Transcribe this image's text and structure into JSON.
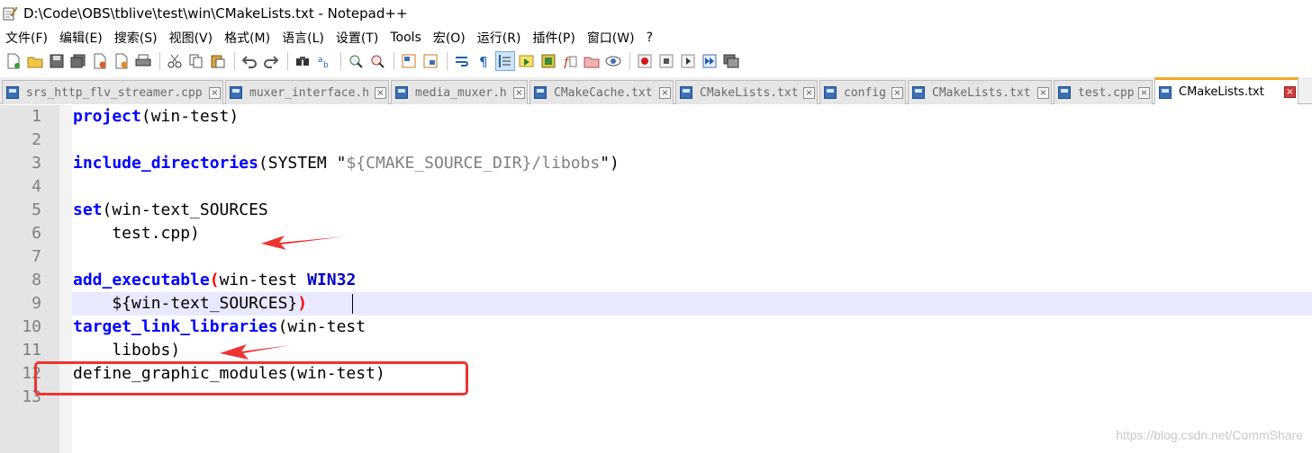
{
  "window": {
    "title": "D:\\Code\\OBS\\tblive\\test\\win\\CMakeLists.txt - Notepad++"
  },
  "menu": [
    {
      "label": "文件(F)"
    },
    {
      "label": "编辑(E)"
    },
    {
      "label": "搜索(S)"
    },
    {
      "label": "视图(V)"
    },
    {
      "label": "格式(M)"
    },
    {
      "label": "语言(L)"
    },
    {
      "label": "设置(T)"
    },
    {
      "label": "Tools"
    },
    {
      "label": "宏(O)"
    },
    {
      "label": "运行(R)"
    },
    {
      "label": "插件(P)"
    },
    {
      "label": "窗口(W)"
    },
    {
      "label": "?"
    }
  ],
  "toolbar": {
    "icons": [
      "new-file-icon",
      "open-file-icon",
      "save-icon",
      "save-all-icon",
      "close-icon",
      "close-all-icon",
      "print-icon",
      "cut-icon",
      "copy-icon",
      "paste-icon",
      "undo-icon",
      "redo-icon",
      "find-icon",
      "replace-icon",
      "zoom-in-icon",
      "zoom-out-icon",
      "sync-vertical-icon",
      "sync-horizontal-icon",
      "word-wrap-icon",
      "show-all-chars-icon",
      "indent-guide-icon",
      "doc-map-icon",
      "function-list-icon",
      "folder-workspace-icon",
      "monitoring-icon",
      "record-macro-icon",
      "stop-record-icon",
      "playback-macro-icon",
      "run-macro-multiple-icon",
      "save-macro-icon"
    ]
  },
  "tabs": [
    {
      "label": "srs_http_flv_streamer.cpp",
      "active": false
    },
    {
      "label": "muxer_interface.h",
      "active": false
    },
    {
      "label": "media_muxer.h",
      "active": false
    },
    {
      "label": "CMakeCache.txt",
      "active": false
    },
    {
      "label": "CMakeLists.txt",
      "active": false
    },
    {
      "label": "config",
      "active": false
    },
    {
      "label": "CMakeLists.txt",
      "active": false
    },
    {
      "label": "test.cpp",
      "active": false
    },
    {
      "label": "CMakeLists.txt",
      "active": true
    }
  ],
  "tab_close_glyph": "×",
  "editor": {
    "line_numbers": [
      "1",
      "2",
      "3",
      "4",
      "5",
      "6",
      "7",
      "8",
      "9",
      "10",
      "11",
      "12",
      "13"
    ],
    "current_line": 9,
    "lines": {
      "l1": {
        "kw": "project",
        "rest": "(win-test)"
      },
      "l3": {
        "kw": "include_directories",
        "rest": "(SYSTEM \"",
        "var": "${CMAKE_SOURCE_DIR}/libobs",
        "end": "\")"
      },
      "l5": {
        "kw": "set",
        "rest": "(win-text_SOURCES"
      },
      "l6": {
        "text": "    test.cpp)"
      },
      "l8": {
        "kw": "add_executable",
        "open": "(",
        "rest": "win-test ",
        "kw2": "WIN32"
      },
      "l9": {
        "text": "    ${win-text_SOURCES}",
        "close": ")"
      },
      "l10": {
        "kw": "target_link_libraries",
        "rest": "(win-test"
      },
      "l11": {
        "text": "    libobs)"
      },
      "l12": {
        "text": "define_graphic_modules(win-test)"
      }
    }
  },
  "annotations": {
    "color": "#ee3333"
  },
  "watermark": "https://blog.csdn.net/CommShare"
}
